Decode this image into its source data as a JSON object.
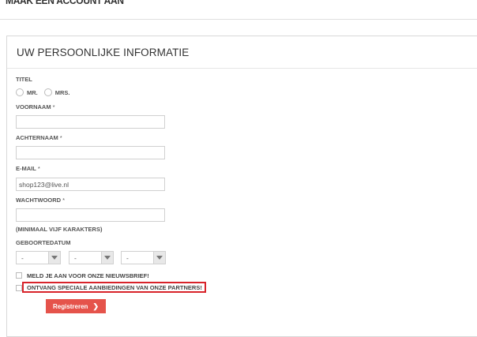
{
  "page": {
    "heading": "MAAK EEN ACCOUNT AAN"
  },
  "form": {
    "section_title": "UW PERSOONLIJKE INFORMATIE",
    "title_label": "TITEL",
    "title_options": [
      "MR.",
      "MRS."
    ],
    "first_name": {
      "label": "VOORNAAM",
      "required": "*",
      "value": ""
    },
    "last_name": {
      "label": "ACHTERNAAM",
      "required": "*",
      "value": ""
    },
    "email": {
      "label": "E-MAIL",
      "required": "*",
      "value": "shop123@live.nl"
    },
    "password": {
      "label": "WACHTWOORD",
      "required": "*",
      "value": "",
      "hint": "(MINIMAAL VIJF KARAKTERS)"
    },
    "birthdate": {
      "label": "GEBOORTEDATUM",
      "day": "-",
      "month": "-",
      "year": "-"
    },
    "newsletter_label": "MELD JE AAN VOOR ONZE NIEUWSBRIEF!",
    "partners_label": "ONTVANG SPECIALE AANBIEDINGEN VAN ONZE PARTNERS!",
    "submit_label": "Registreren",
    "submit_icon": "chevron-right-icon",
    "highlight_color": "#d8232a",
    "button_color": "#e5534b"
  }
}
